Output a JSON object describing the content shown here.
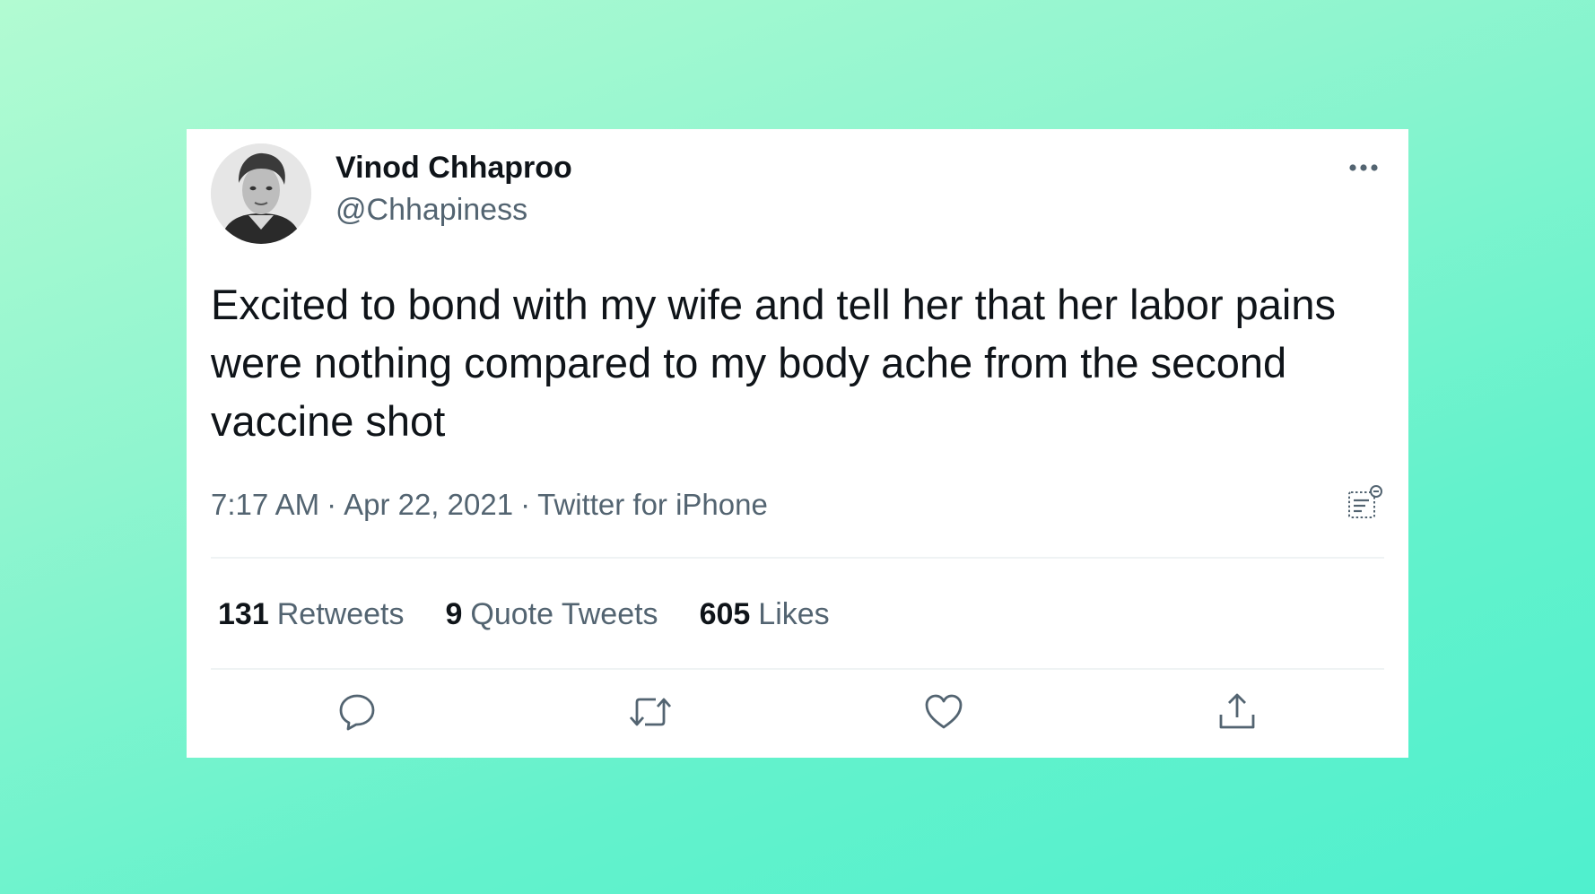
{
  "tweet": {
    "author": {
      "display_name": "Vinod Chhaproo",
      "handle": "@Chhapiness"
    },
    "text": "Excited to bond with my wife and tell her that her labor pains were nothing compared to my body ache from the second vaccine shot",
    "meta": {
      "time": "7:17 AM",
      "date": "Apr 22, 2021",
      "source": "Twitter for iPhone",
      "separator": "·"
    },
    "stats": {
      "retweets_count": "131",
      "retweets_label": "Retweets",
      "quotes_count": "9",
      "quotes_label": "Quote Tweets",
      "likes_count": "605",
      "likes_label": "Likes"
    },
    "icons": {
      "more": "more-horizontal-icon",
      "analytics": "analytics-icon",
      "reply": "reply-icon",
      "retweet": "retweet-icon",
      "like": "heart-icon",
      "share": "share-icon"
    },
    "colors": {
      "text_primary": "#0f1419",
      "text_secondary": "#536471",
      "divider": "#eff3f4",
      "background_gradient_start": "#b2fbd2",
      "background_gradient_end": "#4ff0ce"
    }
  }
}
